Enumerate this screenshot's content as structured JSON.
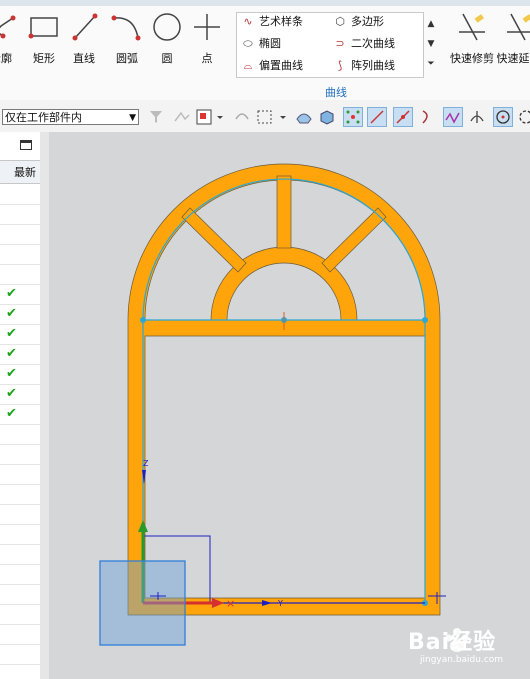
{
  "ribbon": {
    "tools": [
      {
        "label": "轮廓",
        "icon": "profile-icon"
      },
      {
        "label": "矩形",
        "icon": "rectangle-icon"
      },
      {
        "label": "直线",
        "icon": "line-icon"
      },
      {
        "label": "圆弧",
        "icon": "arc-icon"
      },
      {
        "label": "圆",
        "icon": "circle-icon"
      },
      {
        "label": "点",
        "icon": "point-icon"
      }
    ],
    "gallery": [
      {
        "label": "艺术样条",
        "icon": "studio-spline-icon"
      },
      {
        "label": "多边形",
        "icon": "polygon-icon"
      },
      {
        "label": "椭圆",
        "icon": "ellipse-icon"
      },
      {
        "label": "二次曲线",
        "icon": "conic-icon"
      },
      {
        "label": "偏置曲线",
        "icon": "offset-curve-icon"
      },
      {
        "label": "阵列曲线",
        "icon": "pattern-curve-icon"
      }
    ],
    "group_label": "曲线",
    "right_tools": [
      {
        "label": "快速修剪",
        "icon": "quick-trim-icon"
      },
      {
        "label": "快速延",
        "icon": "quick-extend-icon"
      }
    ]
  },
  "toolbar": {
    "filter_value": "仅在工作部件内"
  },
  "nav": {
    "column_header": "最新",
    "checked_rows": 7
  },
  "watermark": {
    "text": "Bai经验",
    "url": "jingyan.baidu.com"
  },
  "colors": {
    "frame": "#ffa40a",
    "curve": "#2aa8d8",
    "canvas": "#d4d6d8",
    "accent": "#1f6fbf"
  }
}
